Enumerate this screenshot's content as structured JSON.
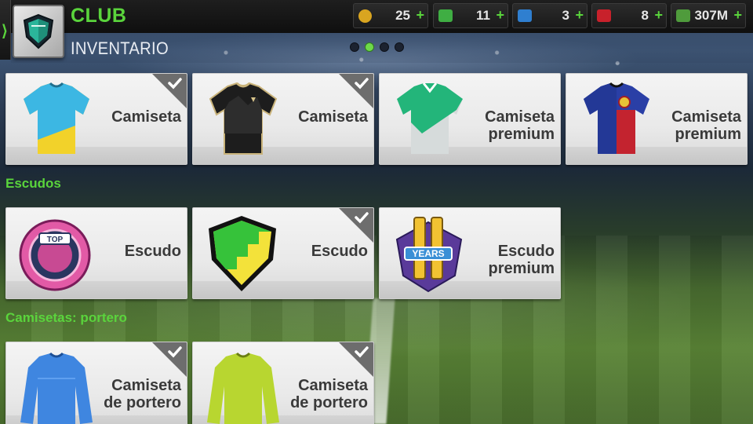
{
  "header": {
    "title": "CLUB",
    "subtitle": "INVENTARIO",
    "page_dots": {
      "count": 4,
      "active_index": 1
    }
  },
  "currencies": [
    {
      "name": "token",
      "icon": "token-icon",
      "value": "25",
      "color": "#d9a520"
    },
    {
      "name": "cash",
      "icon": "cash-icon",
      "value": "11",
      "color": "#3fae43"
    },
    {
      "name": "energy",
      "icon": "energy-icon",
      "value": "3",
      "color": "#2f7fd0"
    },
    {
      "name": "health",
      "icon": "health-icon",
      "value": "8",
      "color": "#c8212b"
    },
    {
      "name": "money",
      "icon": "money-icon",
      "value": "307M",
      "color": "#4f9b3c"
    }
  ],
  "sections": {
    "escudos": "Escudos",
    "goalkeeper": "Camisetas: portero"
  },
  "cards": {
    "shirt1": {
      "line1": "Camiseta",
      "line2": "",
      "checked": true,
      "icon": "shirt-icon"
    },
    "shirt2": {
      "line1": "Camiseta",
      "line2": "",
      "checked": true,
      "icon": "shirt-icon"
    },
    "shirt3": {
      "line1": "Camiseta",
      "line2": "premium",
      "checked": false,
      "icon": "shirt-icon"
    },
    "shirt4": {
      "line1": "Camiseta",
      "line2": "premium",
      "checked": false,
      "icon": "shirt-icon"
    },
    "crest1": {
      "line1": "Escudo",
      "line2": "",
      "checked": false,
      "icon": "crest-icon",
      "crest_text": "TOP"
    },
    "crest2": {
      "line1": "Escudo",
      "line2": "",
      "checked": true,
      "icon": "crest-icon"
    },
    "crest3": {
      "line1": "Escudo",
      "line2": "premium",
      "checked": false,
      "icon": "crest-icon",
      "crest_text": "YEARS"
    },
    "gk1": {
      "line1": "Camiseta",
      "line2": "de portero",
      "checked": true,
      "icon": "goalkeeper-shirt-icon"
    },
    "gk2": {
      "line1": "Camiseta",
      "line2": "de portero",
      "checked": true,
      "icon": "goalkeeper-shirt-icon"
    }
  }
}
